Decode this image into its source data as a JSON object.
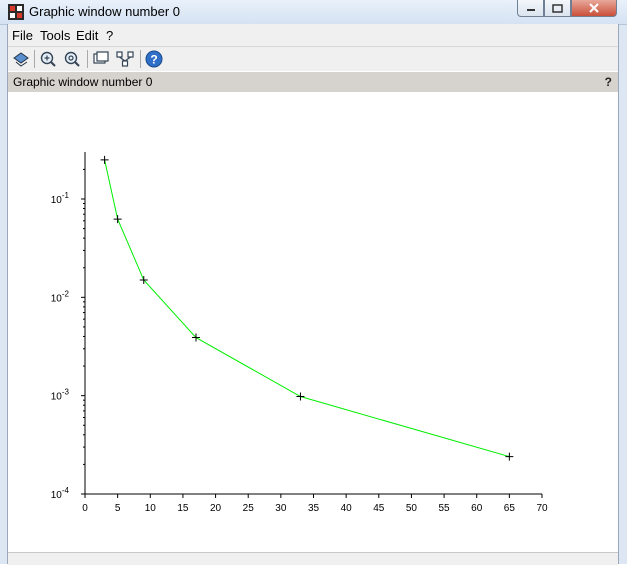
{
  "window": {
    "title": "Graphic window number 0"
  },
  "menu": {
    "items": [
      "File",
      "Tools",
      "Edit",
      "?"
    ]
  },
  "toolbar": {
    "icons": [
      "rotate-icon",
      "zoom-in-icon",
      "zoom-out-icon",
      "datatip-icon",
      "editor-icon",
      "help-icon"
    ]
  },
  "infobar": {
    "text": "Graphic window number 0",
    "help": "?"
  },
  "chart_data": {
    "type": "line",
    "x": [
      3,
      5,
      9,
      17,
      33,
      65
    ],
    "y": [
      0.25,
      0.0625,
      0.015,
      0.0039,
      0.00098,
      0.00024
    ],
    "xlim": [
      0,
      70
    ],
    "ylim": [
      0.0001,
      0.3
    ],
    "yscale": "log",
    "xticks": [
      0,
      5,
      10,
      15,
      20,
      25,
      30,
      35,
      40,
      45,
      50,
      55,
      60,
      65,
      70
    ],
    "ytick_values": [
      0.1,
      0.01,
      0.001,
      0.0001
    ],
    "ytick_base": "10",
    "ytick_exponents": [
      "-1",
      "-2",
      "-3",
      "-4"
    ],
    "line_color": "#00ee00",
    "marker": "+",
    "title": "",
    "xlabel": "",
    "ylabel": "",
    "grid": false
  }
}
